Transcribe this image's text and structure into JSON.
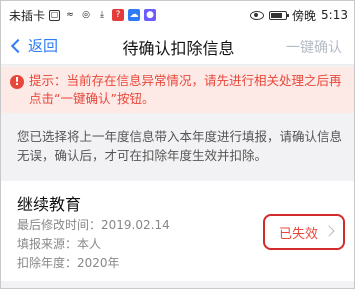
{
  "status_bar": {
    "carrier": "未插卡",
    "time": "5:13",
    "label_right": "傍晚"
  },
  "nav": {
    "back_label": "返回",
    "title": "待确认扣除信息",
    "action_label": "一键确认"
  },
  "warning": {
    "text": "提示：当前存在信息异常情况，请先进行相关处理之后再点击“一键确认”按钮。"
  },
  "info": {
    "text": "您已选择将上一年度信息带入本年度进行填报，请确认信息无误，确认后，才可在扣除年度生效并扣除。"
  },
  "card": {
    "title": "继续教育",
    "last_modified": "最后修改时间：2019.02.14",
    "source": "填报来源：本人",
    "deduction_year": "扣除年度：2020年",
    "status": "已失效"
  },
  "colors": {
    "accent": "#2e7cf6",
    "warning_text": "#e8483b",
    "warning_bg": "#fde9e6",
    "highlight_border": "#d22b2b"
  }
}
